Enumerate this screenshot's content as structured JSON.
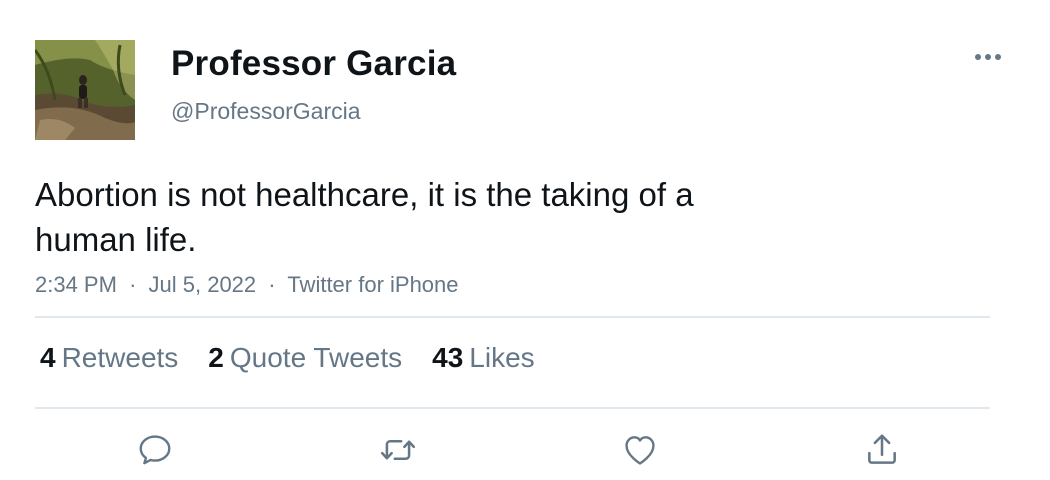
{
  "author": {
    "display_name": "Professor Garcia",
    "handle": "@ProfessorGarcia",
    "avatar": "profile-photo"
  },
  "tweet": {
    "text": "Abortion is not healthcare, it is the taking of a human life.",
    "time": "2:34 PM",
    "date": "Jul 5, 2022",
    "source": "Twitter for iPhone",
    "separator": "·"
  },
  "stats": {
    "retweets": {
      "count": "4",
      "label": "Retweets"
    },
    "quotes": {
      "count": "2",
      "label": "Quote Tweets"
    },
    "likes": {
      "count": "43",
      "label": "Likes"
    }
  },
  "icons": {
    "more": "more-horizontal-icon",
    "reply": "reply-icon",
    "retweet": "retweet-icon",
    "like": "heart-icon",
    "share": "share-icon"
  },
  "colors": {
    "text": "#0f1419",
    "secondary": "#657786",
    "divider": "#e1e8ed"
  }
}
